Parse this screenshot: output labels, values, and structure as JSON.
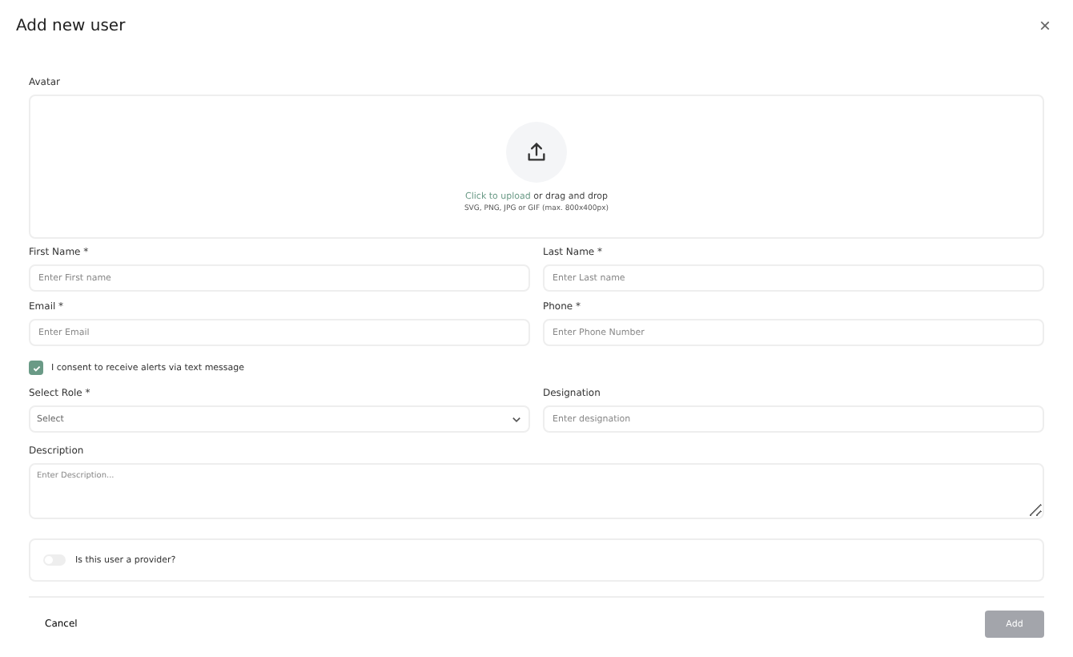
{
  "dialog": {
    "title": "Add new user",
    "close": "×"
  },
  "avatar": {
    "label": "Avatar",
    "link": "Click to upload",
    "rest": " or drag and drop",
    "hint": "SVG, PNG, JPG or GIF (max. 800x400px)"
  },
  "fields": [
    {
      "label": "First Name *",
      "placeholder": "Enter First name",
      "kind": "text"
    },
    {
      "label": "Last Name *",
      "placeholder": "Enter Last name",
      "kind": "text"
    },
    {
      "label": "Email *",
      "placeholder": "Enter Email",
      "kind": "text"
    },
    {
      "label": "Phone *",
      "placeholder": "Enter Phone Number",
      "kind": "text"
    }
  ],
  "consent": {
    "label": "I consent to receive alerts via text message",
    "checked": true
  },
  "fields2": [
    {
      "label": "Select Role *",
      "placeholder": "Select",
      "kind": "select"
    },
    {
      "label": "Designation",
      "placeholder": "Enter designation",
      "kind": "text"
    }
  ],
  "description": {
    "label": "Description",
    "placeholder": "Enter Description..."
  },
  "provider": {
    "label": "Is this user a provider?",
    "on": false
  },
  "buttons": {
    "cancel": "Cancel",
    "add": {
      "label": "Add",
      "disabled": true
    }
  }
}
